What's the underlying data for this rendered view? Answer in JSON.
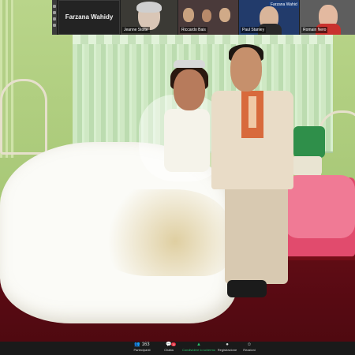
{
  "meeting": {
    "active_speaker": "Farzana Wahidy",
    "participants_tiles": [
      {
        "name": "Jeanne Stolte"
      },
      {
        "name": "Riccardo Bais"
      },
      {
        "name": "Paul Stanley",
        "sub_badge": "Farzana Wahid"
      },
      {
        "name": "Romain Nero"
      }
    ],
    "toolbar": {
      "participants": {
        "label": "Partecipanti",
        "count": "163"
      },
      "chat": {
        "label": "Chatta",
        "badge": "11"
      },
      "share": {
        "label": "Condividere lo schermo",
        "color": "#2ec36c"
      },
      "record": {
        "label": "Registrazione"
      },
      "reactions": {
        "label": "Reazioni"
      }
    }
  },
  "icons": [
    "participants-icon",
    "chat-icon",
    "share-screen-icon",
    "record-icon",
    "reactions-icon"
  ]
}
